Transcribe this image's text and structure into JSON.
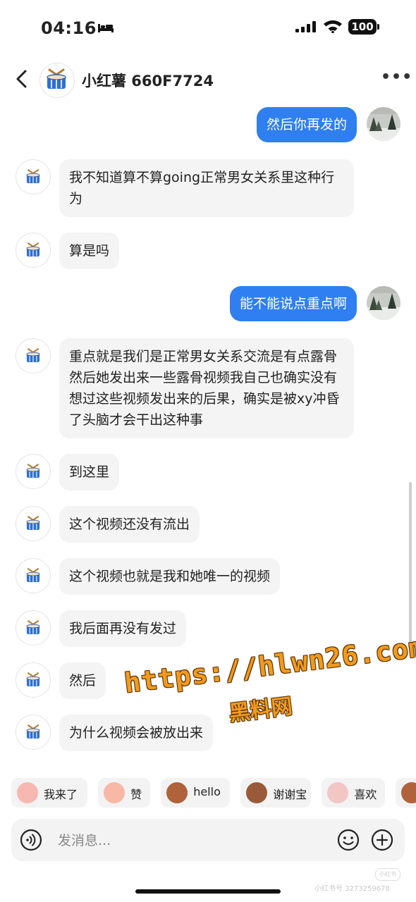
{
  "status_bar": {
    "time": "04:16",
    "battery": "100"
  },
  "header": {
    "title": "小红薯 660F7724"
  },
  "messages": [
    {
      "from": "me",
      "text": "然后你再发的"
    },
    {
      "from": "them",
      "text": "我不知道算不算going正常男女关系里这种行为"
    },
    {
      "from": "them",
      "text": "算是吗"
    },
    {
      "from": "me",
      "text": "能不能说点重点啊"
    },
    {
      "from": "them",
      "text": "重点就是我们是正常男女关系交流是有点露骨然后她发出来一些露骨视频我自己也确实没有想过这些视频发出来的后果，确实是被xy冲昏了头脑才会干出这种事"
    },
    {
      "from": "them",
      "text": "到这里"
    },
    {
      "from": "them",
      "text": "这个视频还没有流出"
    },
    {
      "from": "them",
      "text": "这个视频也就是我和她唯一的视频"
    },
    {
      "from": "them",
      "text": "我后面再没有发过"
    },
    {
      "from": "them",
      "text": "然后"
    },
    {
      "from": "them",
      "text": "为什么视频会被放出来"
    }
  ],
  "watermark": {
    "url": "https://hlwn26.com",
    "label": "黑料网"
  },
  "quick_replies": [
    {
      "label": "我来了",
      "color": "#f6b8b0"
    },
    {
      "label": "赞",
      "color": "#f8b8a6"
    },
    {
      "label": "hello",
      "color": "#b0623a"
    },
    {
      "label": "谢谢宝",
      "color": "#9a5a3a"
    },
    {
      "label": "喜欢",
      "color": "#f3c6c6"
    },
    {
      "label": "",
      "color": "#b0623a"
    }
  ],
  "input": {
    "placeholder": "发消息..."
  },
  "footer_watermark": "小红书号 3273259678",
  "footer_logo": "小红书"
}
